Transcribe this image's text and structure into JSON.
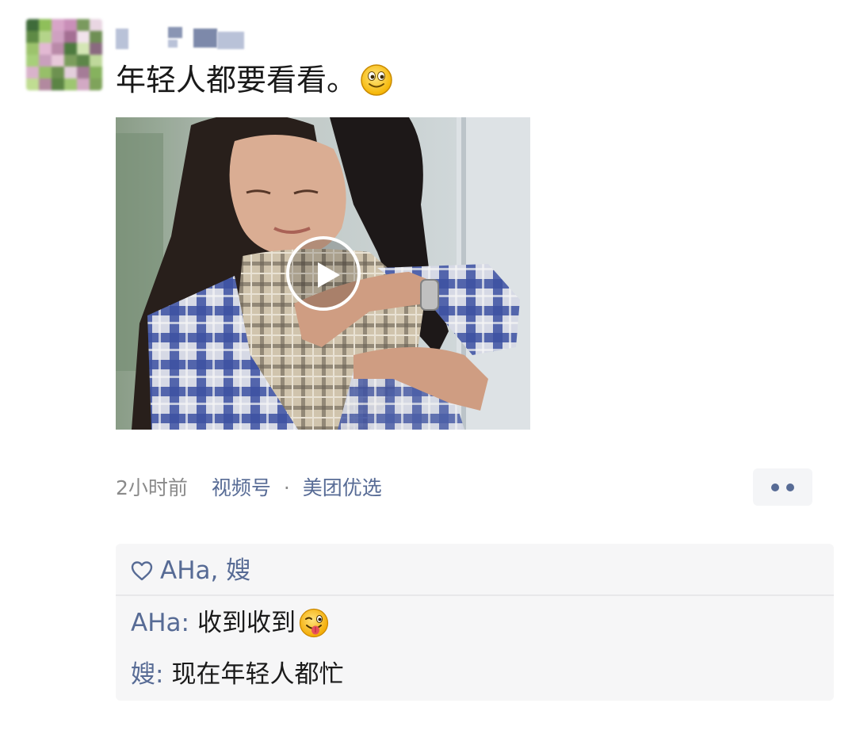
{
  "post": {
    "text": "年轻人都要看看。",
    "emoji": "smile-emoji"
  },
  "video": {
    "play_icon": "play-icon"
  },
  "meta": {
    "time": "2小时前",
    "source": "视频号",
    "separator": "·",
    "store": "美团优选",
    "more_icon": "more-dots-icon"
  },
  "likes": {
    "icon": "heart-icon",
    "names": "AHa, 嫂"
  },
  "comments": [
    {
      "author": "AHa",
      "colon": ":",
      "text": "收到收到",
      "emoji": "wink-tongue-emoji"
    },
    {
      "author": "嫂",
      "colon": ":",
      "text": "现在年轻人都忙"
    }
  ],
  "colors": {
    "link": "#576b95",
    "time": "#8a8a8a",
    "text": "#1a1a1a",
    "comment_bg": "#f6f6f7"
  }
}
